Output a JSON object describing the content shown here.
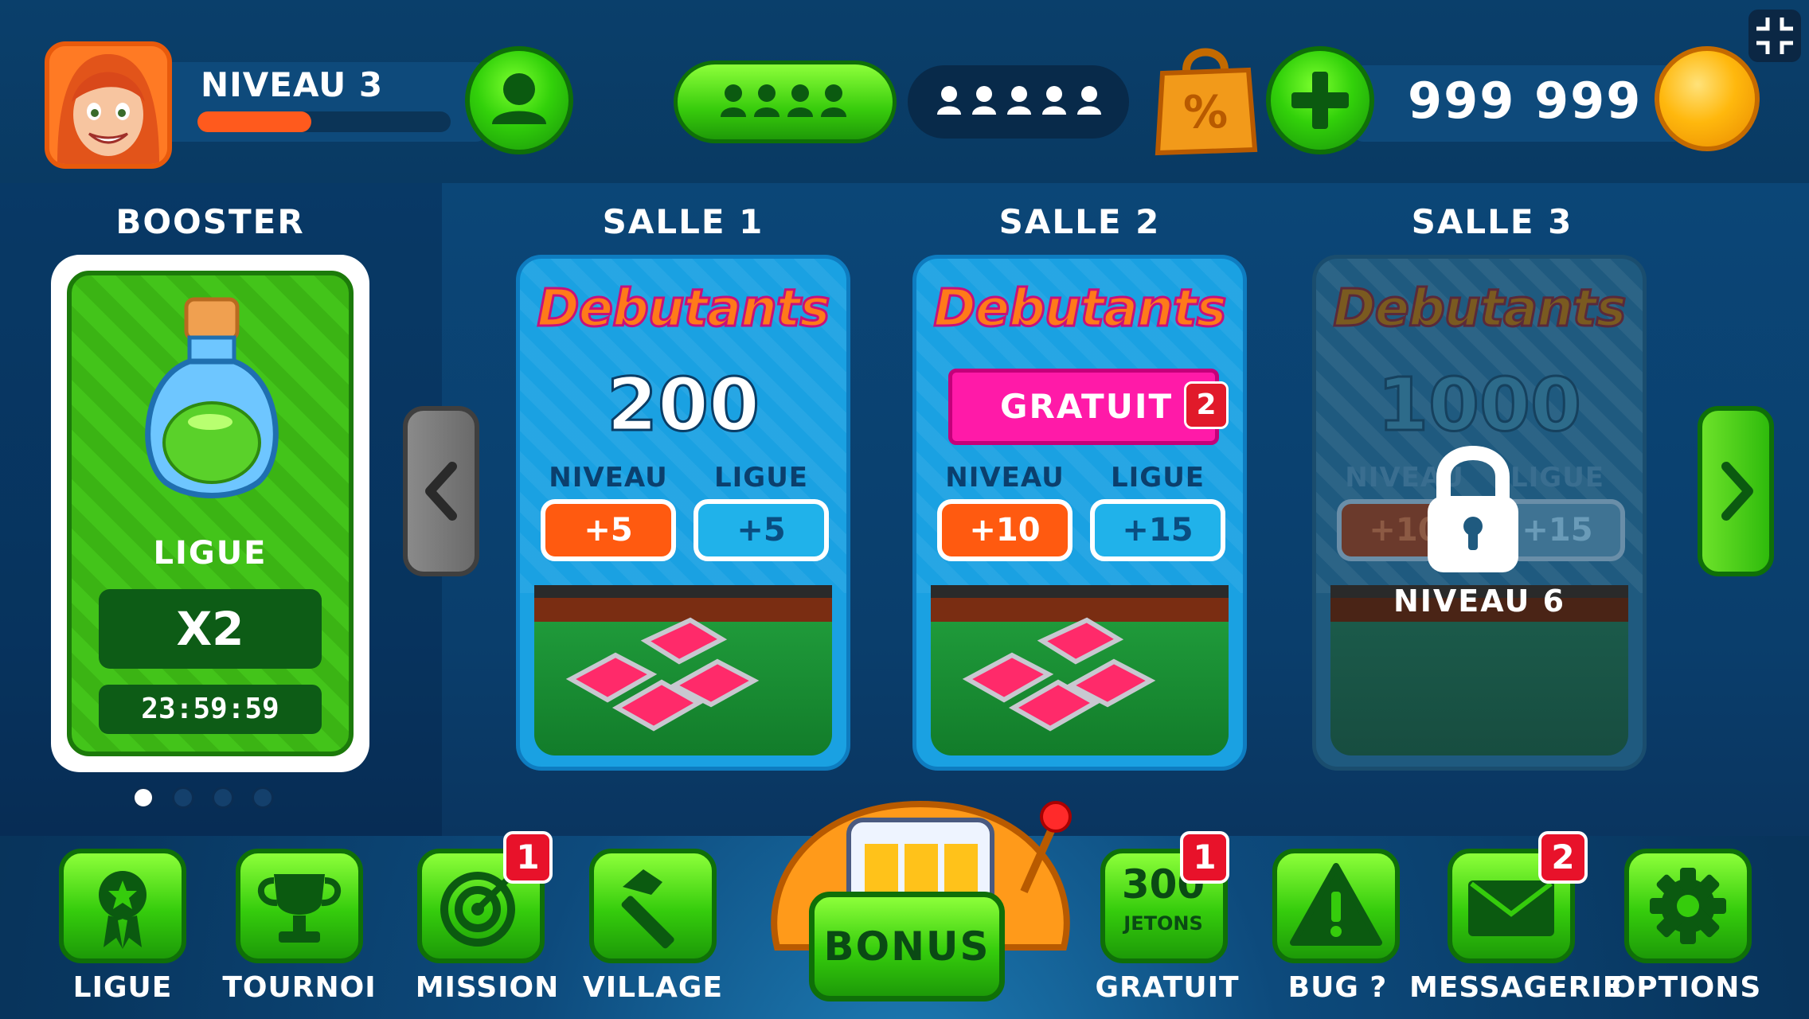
{
  "header": {
    "level_label": "NIVEAU 3",
    "level_progress": 0.45,
    "coins": "999 999"
  },
  "columns": {
    "booster_title": "BOOSTER",
    "room1_title": "SALLE 1",
    "room2_title": "SALLE 2",
    "room3_title": "SALLE 3"
  },
  "booster": {
    "label": "LIGUE",
    "multiplier": "X2",
    "timer": "23:59:59"
  },
  "pager": {
    "count": 4,
    "active": 0
  },
  "rooms": [
    {
      "name": "Debutants",
      "price": "200",
      "niveau_label": "NIVEAU",
      "ligue_label": "LIGUE",
      "niveau_bonus": "+5",
      "ligue_bonus": "+5"
    },
    {
      "name": "Debutants",
      "free_label": "GRATUIT",
      "free_count": "2",
      "niveau_label": "NIVEAU",
      "ligue_label": "LIGUE",
      "niveau_bonus": "+10",
      "ligue_bonus": "+15"
    },
    {
      "name": "Debutants",
      "price": "1000",
      "niveau_label": "NIVEAU",
      "ligue_label": "LIGUE",
      "niveau_bonus": "+10",
      "ligue_bonus": "+15",
      "lock_text": "NIVEAU 6"
    }
  ],
  "nav": {
    "ligue": "LIGUE",
    "tournoi": "TOURNOI",
    "mission": "MISSION",
    "mission_badge": "1",
    "village": "VILLAGE",
    "bonus": "BONUS",
    "gratuit": "GRATUIT",
    "gratuit_badge": "1",
    "jetons_amount": "300",
    "jetons_label": "JETONS",
    "bug": "BUG ?",
    "messagerie": "MESSAGERIE",
    "messagerie_badge": "2",
    "options": "OPTIONS"
  },
  "colors": {
    "accent_green": "#35cc0c",
    "accent_orange": "#ff5a10",
    "badge_red": "#e8122a",
    "room_blue": "#1aa1e2",
    "free_pink": "#ff1aa8"
  }
}
